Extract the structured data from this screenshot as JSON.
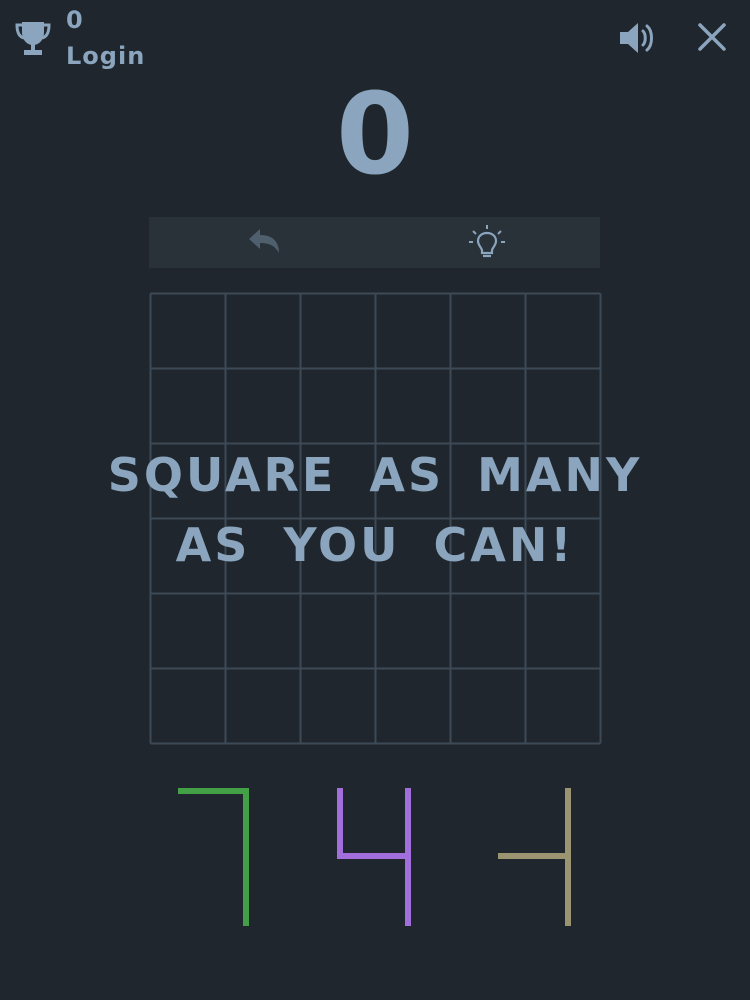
{
  "header": {
    "best_score": "0",
    "login_label": "Login",
    "icons": [
      "trophy-icon",
      "speaker-icon",
      "close-icon"
    ]
  },
  "game": {
    "score": "0",
    "message": "SQUARE AS MANY AS YOU CAN!",
    "grid_rows": 6,
    "grid_cols": 6
  },
  "toolbar": {
    "icons": [
      "undo-icon",
      "lightbulb-icon"
    ]
  },
  "pieces": [
    {
      "name": "green-piece",
      "color": "#43a047"
    },
    {
      "name": "purple-piece",
      "color": "#a16edc"
    },
    {
      "name": "olive-piece",
      "color": "#9a9470"
    }
  ],
  "colors": {
    "background": "#1f262d",
    "accent": "#8aa5bd",
    "toolbar_bg": "#293139",
    "grid_line": "#3d4a56"
  }
}
